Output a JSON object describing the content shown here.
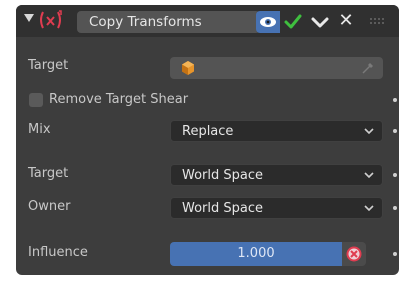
{
  "header": {
    "name_value": "Copy Transforms",
    "icons": [
      "collapse-arrow-icon",
      "copy-transforms-constraint-icon",
      "eye-icon",
      "checkmark-icon",
      "chevron-down-icon",
      "close-icon",
      "grip-icon"
    ]
  },
  "rows": {
    "target_label": "Target",
    "remove_shear_label": "Remove Target Shear",
    "remove_shear_checked": false,
    "mix_label": "Mix",
    "mix_value": "Replace",
    "target_space_label": "Target",
    "target_space_value": "World Space",
    "owner_space_label": "Owner",
    "owner_space_value": "World Space",
    "influence_label": "Influence",
    "influence_value": "1.000"
  },
  "colors": {
    "panel_bg": "#3d3d3d",
    "header_bg": "#303030",
    "accent_blue": "#4772b3",
    "check_green": "#3fbf3f",
    "object_orange": "#e8952b",
    "clear_red": "#e03c50"
  }
}
